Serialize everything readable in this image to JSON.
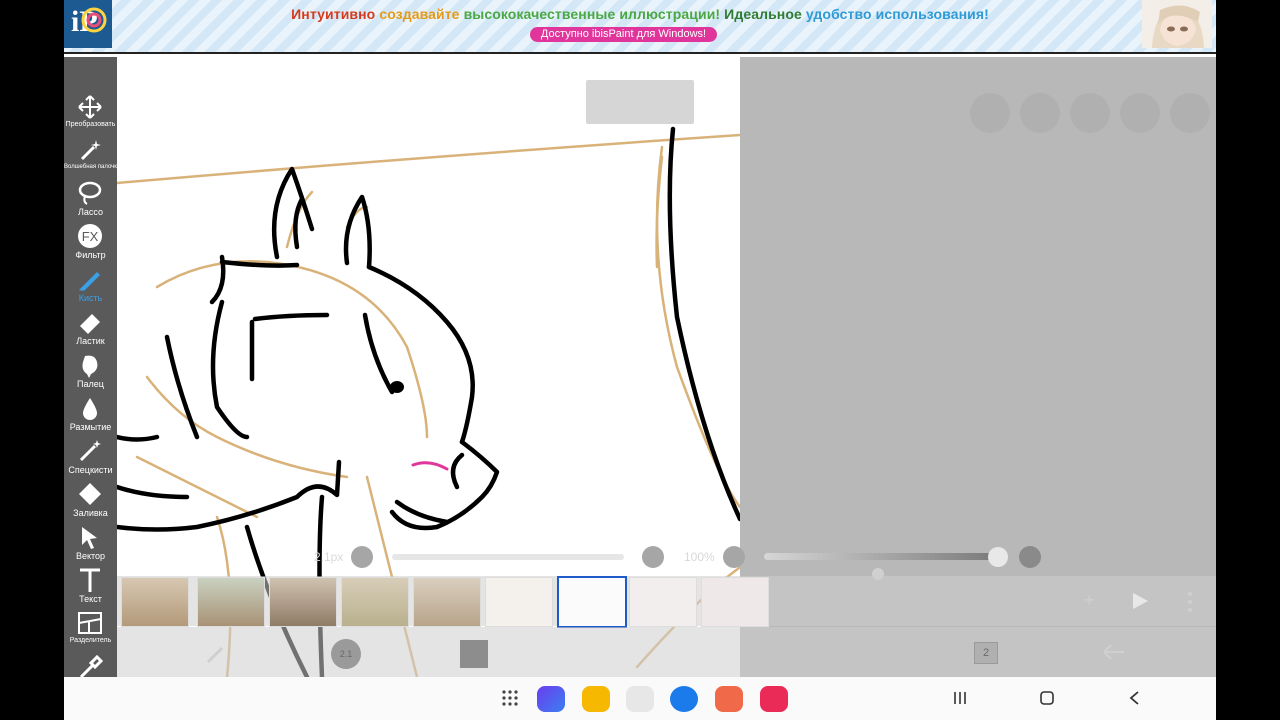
{
  "banner": {
    "logo_text": "iP",
    "headline_parts": [
      {
        "text": "Интуитивно",
        "color": "#d63a1c"
      },
      {
        "text": "создавайте",
        "color": "#e59a17"
      },
      {
        "text": "высококачественные",
        "color": "#4aa843"
      },
      {
        "text": "иллюстрации!",
        "color": "#4aa843"
      },
      {
        "text": "Идеальное",
        "color": "#2e7d32"
      },
      {
        "text": "удобство",
        "color": "#2f9bd6"
      },
      {
        "text": "использования!",
        "color": "#2f9bd6"
      }
    ],
    "pill": "Доступно ibisPaint для Windows!"
  },
  "toolbar": {
    "tools": [
      {
        "label": "Преобразовать",
        "icon": "move-icon"
      },
      {
        "label": "Волшебная палочка",
        "icon": "magic-wand-icon"
      },
      {
        "label": "Лассо",
        "icon": "lasso-icon"
      },
      {
        "label": "Фильтр",
        "icon": "fx-icon"
      },
      {
        "label": "Кисть",
        "icon": "brush-icon",
        "active": true
      },
      {
        "label": "Ластик",
        "icon": "eraser-icon"
      },
      {
        "label": "Палец",
        "icon": "finger-icon"
      },
      {
        "label": "Размытие",
        "icon": "blur-icon"
      },
      {
        "label": "Спецкисти",
        "icon": "special-brush-icon"
      },
      {
        "label": "Заливка",
        "icon": "fill-icon"
      },
      {
        "label": "Вектор",
        "icon": "vector-icon"
      },
      {
        "label": "Текст",
        "icon": "text-icon"
      },
      {
        "label": "Разделитель",
        "icon": "divider-icon"
      },
      {
        "label": "",
        "icon": "eyedropper-icon"
      }
    ]
  },
  "sliders": {
    "brush_size": "2.1px",
    "opacity": "100%"
  },
  "bottom": {
    "layer_count": "2",
    "brush_badge": "2.1"
  },
  "frames": {
    "selected_index": 6,
    "count": 9
  },
  "colors": {
    "toolbar_bg": "#5a5a5a",
    "active_tool": "#3aa0e8",
    "sketch_line": "#d9b27a",
    "ink": "#000000",
    "accent_pink": "#e0369b",
    "selected_frame": "#1e5ac8"
  }
}
